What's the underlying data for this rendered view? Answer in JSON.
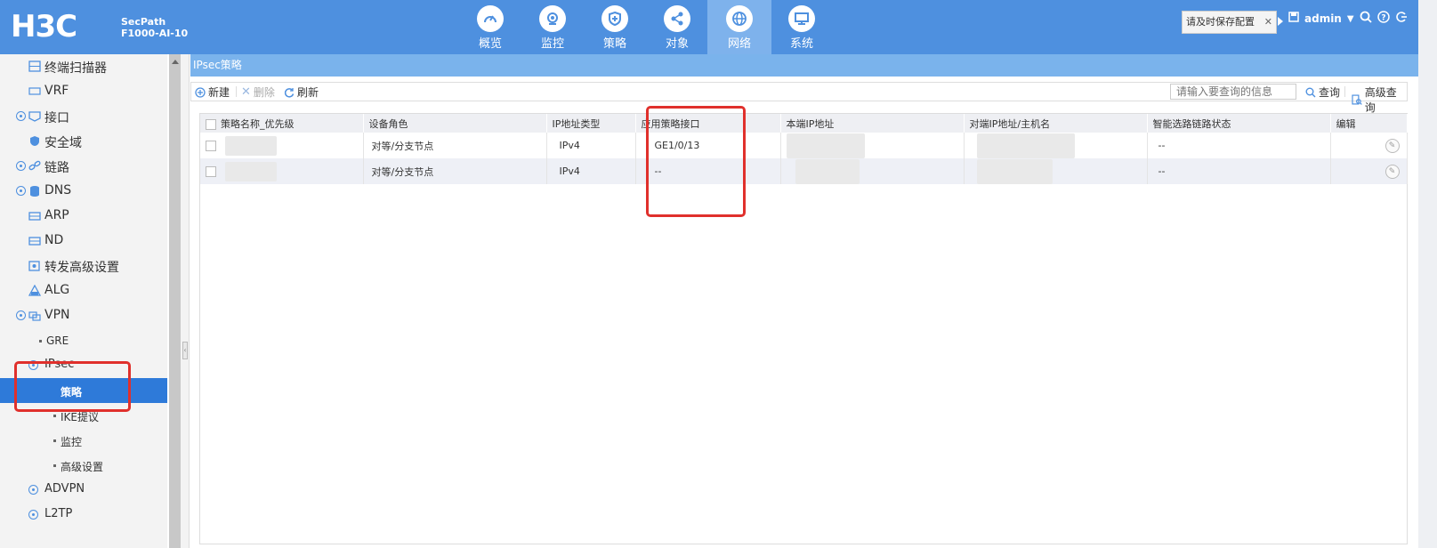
{
  "header": {
    "logo": "H3C",
    "product_line1": "SecPath",
    "product_line2": "F1000-AI-10",
    "nav": [
      {
        "label": "概览",
        "icon": "gauge-icon"
      },
      {
        "label": "监控",
        "icon": "camera-icon"
      },
      {
        "label": "策略",
        "icon": "shield-plus-icon"
      },
      {
        "label": "对象",
        "icon": "share-icon"
      },
      {
        "label": "网络",
        "icon": "globe-icon",
        "active": true
      },
      {
        "label": "系统",
        "icon": "monitor-icon"
      }
    ],
    "save_tip": "请及时保存配置",
    "user": "admin"
  },
  "sidebar": {
    "items": [
      {
        "label": "终端扫描器",
        "icon": "scanner-icon"
      },
      {
        "label": "VRF",
        "icon": "vrf-icon"
      },
      {
        "label": "接口",
        "icon": "interface-icon",
        "expandable": true
      },
      {
        "label": "安全域",
        "icon": "shield-icon"
      },
      {
        "label": "链路",
        "icon": "link-icon",
        "expandable": true
      },
      {
        "label": "DNS",
        "icon": "database-icon",
        "expandable": true
      },
      {
        "label": "ARP",
        "icon": "arp-icon"
      },
      {
        "label": "ND",
        "icon": "nd-icon"
      },
      {
        "label": "转发高级设置",
        "icon": "settings-icon"
      },
      {
        "label": "ALG",
        "icon": "alg-icon"
      },
      {
        "label": "VPN",
        "icon": "vpn-icon",
        "expandable": true
      }
    ],
    "vpn_children": {
      "gre": "GRE",
      "ipsec": "IPsec",
      "ipsec_children": [
        "策略",
        "IKE提议",
        "监控",
        "高级设置"
      ],
      "advpn": "ADVPN",
      "l2tp": "L2TP"
    }
  },
  "main": {
    "breadcrumb": "IPsec策略",
    "toolbar": {
      "new": "新建",
      "delete": "删除",
      "refresh": "刷新",
      "search_placeholder": "请输入要查询的信息",
      "query": "查询",
      "advanced_query": "高级查询"
    },
    "table": {
      "columns": [
        "策略名称_优先级",
        "设备角色",
        "IP地址类型",
        "应用策略接口",
        "本端IP地址",
        "对端IP地址/主机名",
        "智能选路链路状态",
        "编辑"
      ],
      "rows": [
        {
          "role": "对等/分支节点",
          "ip_type": "IPv4",
          "interface": "GE1/0/13",
          "link_state": "--"
        },
        {
          "role": "对等/分支节点",
          "ip_type": "IPv4",
          "interface": "--",
          "link_state": "--"
        }
      ]
    }
  },
  "colors": {
    "header_bg": "#4e90df",
    "active_nav": "#7eb2ec",
    "active_sidebar": "#2e7ad9",
    "highlight_red": "#e0302c"
  }
}
